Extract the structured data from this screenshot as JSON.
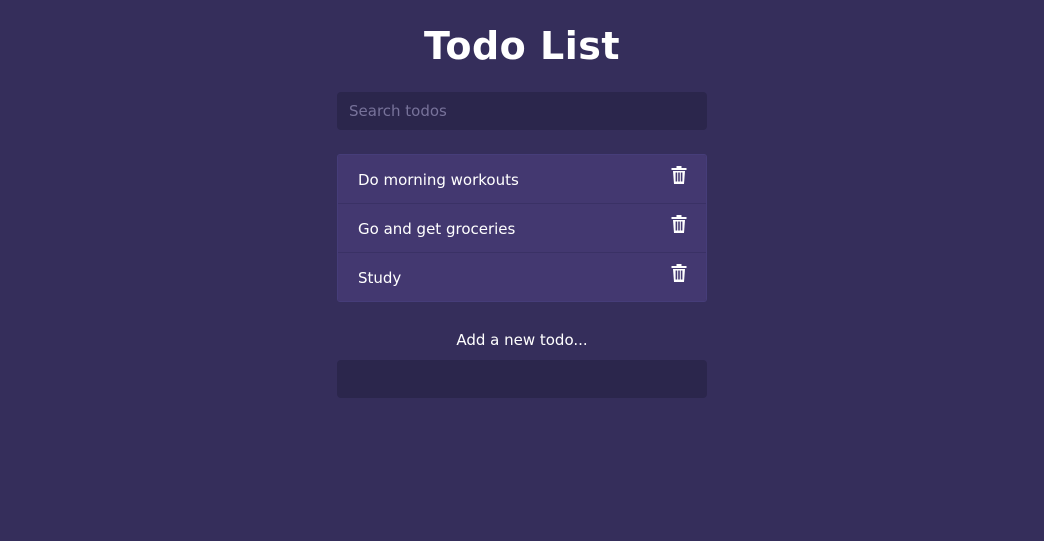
{
  "header": {
    "title": "Todo List"
  },
  "search": {
    "placeholder": "Search todos",
    "value": ""
  },
  "todos": [
    {
      "label": "Do morning workouts",
      "icon": "trash-icon"
    },
    {
      "label": "Go and get groceries",
      "icon": "trash-icon"
    },
    {
      "label": "Study",
      "icon": "trash-icon"
    }
  ],
  "add_form": {
    "label": "Add a new todo...",
    "value": ""
  },
  "colors": {
    "background": "#352e5b",
    "input_bg": "#2b264c",
    "item_bg": "#433870",
    "text": "#ffffff"
  }
}
